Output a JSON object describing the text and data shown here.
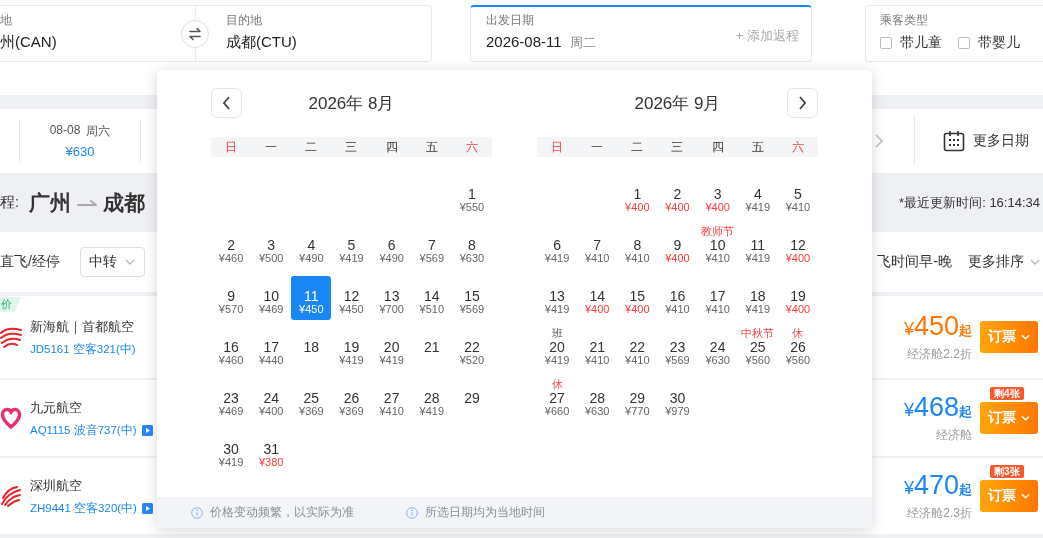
{
  "search": {
    "origin": {
      "label": "地",
      "value": "州(CAN)"
    },
    "destination": {
      "label": "目的地",
      "value": "成都(CTU)"
    },
    "date": {
      "label": "出发日期",
      "value": "2026-08-11",
      "weekday": "周二",
      "return_link": "+ 添加返程"
    },
    "passengers": {
      "label": "乘客类型",
      "options": [
        {
          "label": "带儿童",
          "checked": false
        },
        {
          "label": "带婴儿",
          "checked": false
        }
      ]
    }
  },
  "date_strip": {
    "dates": [
      {
        "date": "08-08",
        "weekday": "周六",
        "price": "¥630",
        "selected": false
      }
    ],
    "more": "更多日期"
  },
  "route_bar": {
    "prefix": "程:",
    "from": "广州",
    "to": "成都",
    "updated": "*最近更新时间: 16:14:34"
  },
  "filters": {
    "stops": "直飞/经停",
    "transfer": "中转",
    "sort": "飞时间早-晚",
    "more_sort": "更多排序"
  },
  "flights": [
    {
      "badge": "价",
      "name": "新海航｜首都航空",
      "flight": "JD5161 空客321(中)",
      "play_icon": false,
      "currency": "¥",
      "amount": "450",
      "suffix": "起",
      "cabin": "经济舱2.2折",
      "lowest": true,
      "book": "订票"
    },
    {
      "name": "九元航空",
      "flight": "AQ1115 波音737(中)",
      "play_icon": true,
      "currency": "¥",
      "amount": "468",
      "suffix": "起",
      "cabin": "经济舱",
      "lowest": false,
      "seats_left": "剩4张",
      "book": "订票"
    },
    {
      "name": "深圳航空",
      "flight": "ZH9441 空客320(中)",
      "play_icon": true,
      "currency": "¥",
      "amount": "470",
      "suffix": "起",
      "cabin": "经济舱2.3折",
      "lowest": false,
      "seats_left": "剩3张",
      "book": "订票"
    }
  ],
  "calendar": {
    "months": [
      {
        "kind": "prev",
        "title": "2026年 8月",
        "weekdays": [
          {
            "label": "日",
            "weekend": true
          },
          {
            "label": "一",
            "weekend": false
          },
          {
            "label": "二",
            "weekend": false
          },
          {
            "label": "三",
            "weekend": false
          },
          {
            "label": "四",
            "weekend": false
          },
          {
            "label": "五",
            "weekend": false
          },
          {
            "label": "六",
            "weekend": true
          }
        ],
        "days": [
          {
            "kind": "blank"
          },
          {
            "kind": "blank"
          },
          {
            "kind": "blank"
          },
          {
            "kind": "blank"
          },
          {
            "kind": "blank"
          },
          {
            "kind": "blank"
          },
          {
            "kind": "day",
            "day": "1",
            "price": "¥550",
            "low": false,
            "selected": false
          },
          {
            "kind": "day",
            "day": "2",
            "price": "¥460",
            "low": false,
            "selected": false
          },
          {
            "kind": "day",
            "day": "3",
            "price": "¥500",
            "low": false,
            "selected": false
          },
          {
            "kind": "day",
            "day": "4",
            "price": "¥490",
            "low": false,
            "selected": false
          },
          {
            "kind": "day",
            "day": "5",
            "price": "¥419",
            "low": false,
            "selected": false
          },
          {
            "kind": "day",
            "day": "6",
            "price": "¥490",
            "low": false,
            "selected": false
          },
          {
            "kind": "day",
            "day": "7",
            "price": "¥569",
            "low": false,
            "selected": false
          },
          {
            "kind": "day",
            "day": "8",
            "price": "¥630",
            "low": false,
            "selected": false
          },
          {
            "kind": "day",
            "day": "9",
            "price": "¥570",
            "low": false,
            "selected": false
          },
          {
            "kind": "day",
            "day": "10",
            "price": "¥469",
            "low": false,
            "selected": false
          },
          {
            "kind": "day",
            "day": "11",
            "price": "¥450",
            "low": false,
            "selected": true
          },
          {
            "kind": "day",
            "day": "12",
            "price": "¥450",
            "low": false,
            "selected": false
          },
          {
            "kind": "day",
            "day": "13",
            "price": "¥700",
            "low": false,
            "selected": false
          },
          {
            "kind": "day",
            "day": "14",
            "price": "¥510",
            "low": false,
            "selected": false
          },
          {
            "kind": "day",
            "day": "15",
            "price": "¥569",
            "low": false,
            "selected": false
          },
          {
            "kind": "day",
            "day": "16",
            "price": "¥460",
            "low": false,
            "selected": false
          },
          {
            "kind": "day",
            "day": "17",
            "price": "¥440",
            "low": false,
            "selected": false
          },
          {
            "kind": "day",
            "day": "18",
            "selected": false
          },
          {
            "kind": "day",
            "day": "19",
            "price": "¥419",
            "low": false,
            "selected": false
          },
          {
            "kind": "day",
            "day": "20",
            "price": "¥419",
            "low": false,
            "selected": false
          },
          {
            "kind": "day",
            "day": "21",
            "selected": false
          },
          {
            "kind": "day",
            "day": "22",
            "price": "¥520",
            "low": false,
            "selected": false
          },
          {
            "kind": "day",
            "day": "23",
            "price": "¥469",
            "low": false,
            "selected": false
          },
          {
            "kind": "day",
            "day": "24",
            "price": "¥400",
            "low": false,
            "selected": false
          },
          {
            "kind": "day",
            "day": "25",
            "price": "¥369",
            "low": false,
            "selected": false
          },
          {
            "kind": "day",
            "day": "26",
            "price": "¥369",
            "low": false,
            "selected": false
          },
          {
            "kind": "day",
            "day": "27",
            "price": "¥410",
            "low": false,
            "selected": false
          },
          {
            "kind": "day",
            "day": "28",
            "price": "¥419",
            "low": false,
            "selected": false
          },
          {
            "kind": "day",
            "day": "29",
            "selected": false
          },
          {
            "kind": "day",
            "day": "30",
            "price": "¥419",
            "low": false,
            "selected": false
          },
          {
            "kind": "day",
            "day": "31",
            "price": "¥380",
            "low": true,
            "selected": false
          }
        ]
      },
      {
        "kind": "next",
        "title": "2026年 9月",
        "weekdays": [
          {
            "label": "日",
            "weekend": true
          },
          {
            "label": "一",
            "weekend": false
          },
          {
            "label": "二",
            "weekend": false
          },
          {
            "label": "三",
            "weekend": false
          },
          {
            "label": "四",
            "weekend": false
          },
          {
            "label": "五",
            "weekend": false
          },
          {
            "label": "六",
            "weekend": true
          }
        ],
        "days": [
          {
            "kind": "blank"
          },
          {
            "kind": "blank"
          },
          {
            "kind": "day",
            "day": "1",
            "price": "¥400",
            "low": true,
            "selected": false
          },
          {
            "kind": "day",
            "day": "2",
            "price": "¥400",
            "low": true,
            "selected": false
          },
          {
            "kind": "day",
            "day": "3",
            "price": "¥400",
            "low": true,
            "selected": false
          },
          {
            "kind": "day",
            "day": "4",
            "price": "¥419",
            "low": false,
            "selected": false
          },
          {
            "kind": "day",
            "day": "5",
            "price": "¥410",
            "low": false,
            "selected": false
          },
          {
            "kind": "day",
            "day": "6",
            "price": "¥419",
            "low": false,
            "selected": false
          },
          {
            "kind": "day",
            "day": "7",
            "price": "¥410",
            "low": false,
            "selected": false
          },
          {
            "kind": "day",
            "day": "8",
            "price": "¥410",
            "low": false,
            "selected": false
          },
          {
            "kind": "day",
            "day": "9",
            "price": "¥400",
            "low": true,
            "selected": false
          },
          {
            "kind": "day",
            "day": "10",
            "price": "¥410",
            "low": false,
            "selected": false,
            "tag": {
              "text": "教师节",
              "kind": "holiday"
            }
          },
          {
            "kind": "day",
            "day": "11",
            "price": "¥419",
            "low": false,
            "selected": false
          },
          {
            "kind": "day",
            "day": "12",
            "price": "¥400",
            "low": true,
            "selected": false
          },
          {
            "kind": "day",
            "day": "13",
            "price": "¥419",
            "low": false,
            "selected": false
          },
          {
            "kind": "day",
            "day": "14",
            "price": "¥400",
            "low": true,
            "selected": false
          },
          {
            "kind": "day",
            "day": "15",
            "price": "¥400",
            "low": true,
            "selected": false
          },
          {
            "kind": "day",
            "day": "16",
            "price": "¥410",
            "low": false,
            "selected": false
          },
          {
            "kind": "day",
            "day": "17",
            "price": "¥410",
            "low": false,
            "selected": false
          },
          {
            "kind": "day",
            "day": "18",
            "price": "¥419",
            "low": false,
            "selected": false
          },
          {
            "kind": "day",
            "day": "19",
            "price": "¥400",
            "low": true,
            "selected": false
          },
          {
            "kind": "day",
            "day": "20",
            "price": "¥419",
            "low": false,
            "selected": false,
            "tag": {
              "text": "班",
              "kind": "workday"
            }
          },
          {
            "kind": "day",
            "day": "21",
            "price": "¥410",
            "low": false,
            "selected": false
          },
          {
            "kind": "day",
            "day": "22",
            "price": "¥410",
            "low": false,
            "selected": false
          },
          {
            "kind": "day",
            "day": "23",
            "price": "¥569",
            "low": false,
            "selected": false
          },
          {
            "kind": "day",
            "day": "24",
            "price": "¥630",
            "low": false,
            "selected": false
          },
          {
            "kind": "day",
            "day": "25",
            "price": "¥560",
            "low": false,
            "selected": false,
            "tag": {
              "text": "中秋节",
              "kind": "holiday"
            }
          },
          {
            "kind": "day",
            "day": "26",
            "price": "¥560",
            "low": false,
            "selected": false,
            "tag": {
              "text": "休",
              "kind": "holiday"
            }
          },
          {
            "kind": "day",
            "day": "27",
            "price": "¥660",
            "low": false,
            "selected": false,
            "tag": {
              "text": "休",
              "kind": "holiday"
            }
          },
          {
            "kind": "day",
            "day": "28",
            "price": "¥630",
            "low": false,
            "selected": false
          },
          {
            "kind": "day",
            "day": "29",
            "price": "¥770",
            "low": false,
            "selected": false
          },
          {
            "kind": "day",
            "day": "30",
            "price": "¥979",
            "low": false,
            "selected": false
          }
        ]
      }
    ],
    "notes": [
      "价格变动频繁，以实际为准",
      "所选日期均为当地时间"
    ]
  }
}
